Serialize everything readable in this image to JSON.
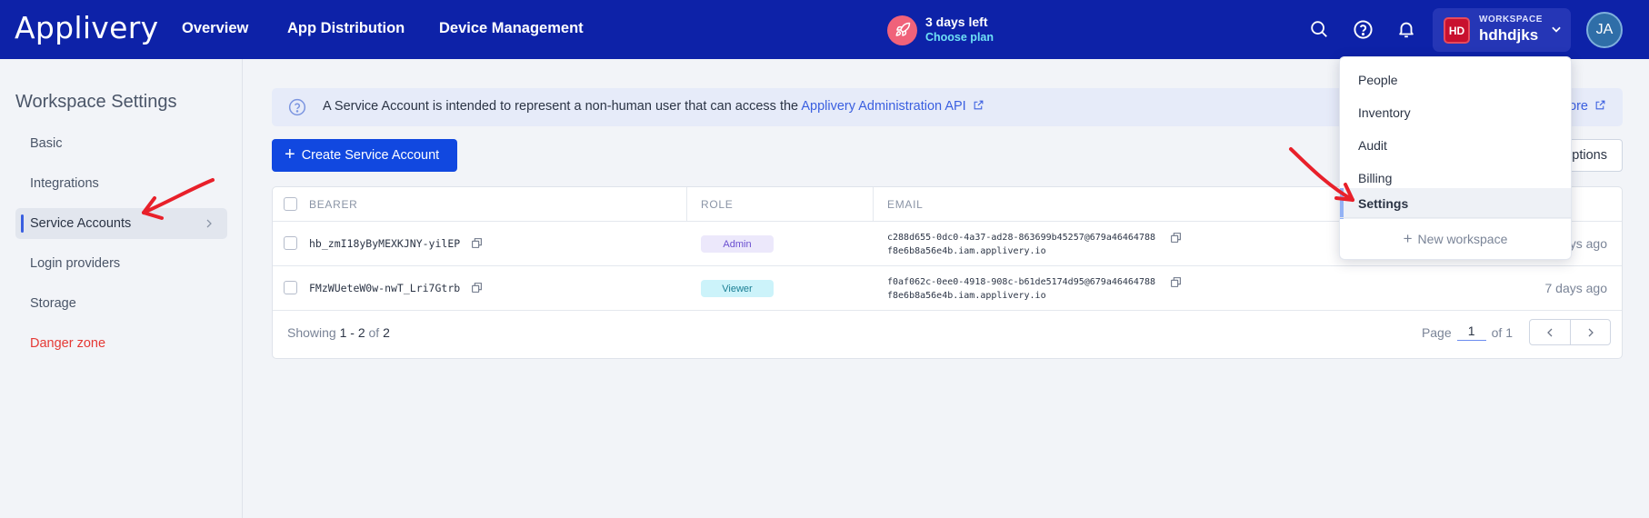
{
  "app": {
    "logo": "Applivery"
  },
  "nav": {
    "overview": "Overview",
    "app_distribution": "App Distribution",
    "device_management": "Device Management"
  },
  "trial": {
    "days_left": "3 days left",
    "choose_plan": "Choose plan"
  },
  "workspace": {
    "badge": "HD",
    "caption": "WORKSPACE",
    "name": "hdhdjks"
  },
  "user": {
    "initials": "JA"
  },
  "sidebar": {
    "title": "Workspace Settings",
    "items": [
      {
        "label": "Basic"
      },
      {
        "label": "Integrations"
      },
      {
        "label": "Service Accounts",
        "active": true
      },
      {
        "label": "Login providers"
      },
      {
        "label": "Storage"
      },
      {
        "label": "Danger zone"
      }
    ]
  },
  "info": {
    "text_before": "A Service Account is intended to represent a non-human user that can access the",
    "link": "Applivery Administration API",
    "right_link": "ore"
  },
  "toolbar": {
    "create_label": "Create Service Account",
    "options_label": "ptions"
  },
  "table": {
    "headers": {
      "bearer": "BEARER",
      "role": "ROLE",
      "email": "EMAIL"
    },
    "rows": [
      {
        "bearer": "hb_zmI18yByMEXKJNY-yilEP",
        "role": "Admin",
        "email_line1": "c288d655-0dc0-4a37-ad28-863699b45257@679a46464788",
        "email_line2": "f8e6b8a56e4b.iam.applivery.io",
        "time": "ays ago"
      },
      {
        "bearer": "FMzWUeteW0w-nwT_Lri7Gtrb",
        "role": "Viewer",
        "email_line1": "f0af062c-0ee0-4918-908c-b61de5174d95@679a46464788",
        "email_line2": "f8e6b8a56e4b.iam.applivery.io",
        "time": "7 days ago"
      }
    ],
    "showing": {
      "prefix": "Showing",
      "range": "1 - 2",
      "of": "of",
      "total": "2"
    },
    "pager": {
      "page_label": "Page",
      "page": "1",
      "of_label": "of 1"
    }
  },
  "dropdown": {
    "items": [
      {
        "label": "People"
      },
      {
        "label": "Inventory"
      },
      {
        "label": "Audit"
      },
      {
        "label": "Billing"
      },
      {
        "label": "Settings",
        "selected": true
      }
    ],
    "new_workspace": "New workspace"
  },
  "colors": {
    "topbar": "#0d22a8",
    "primary": "#1148e0",
    "danger": "#e53935",
    "annotation": "#e8202a"
  }
}
